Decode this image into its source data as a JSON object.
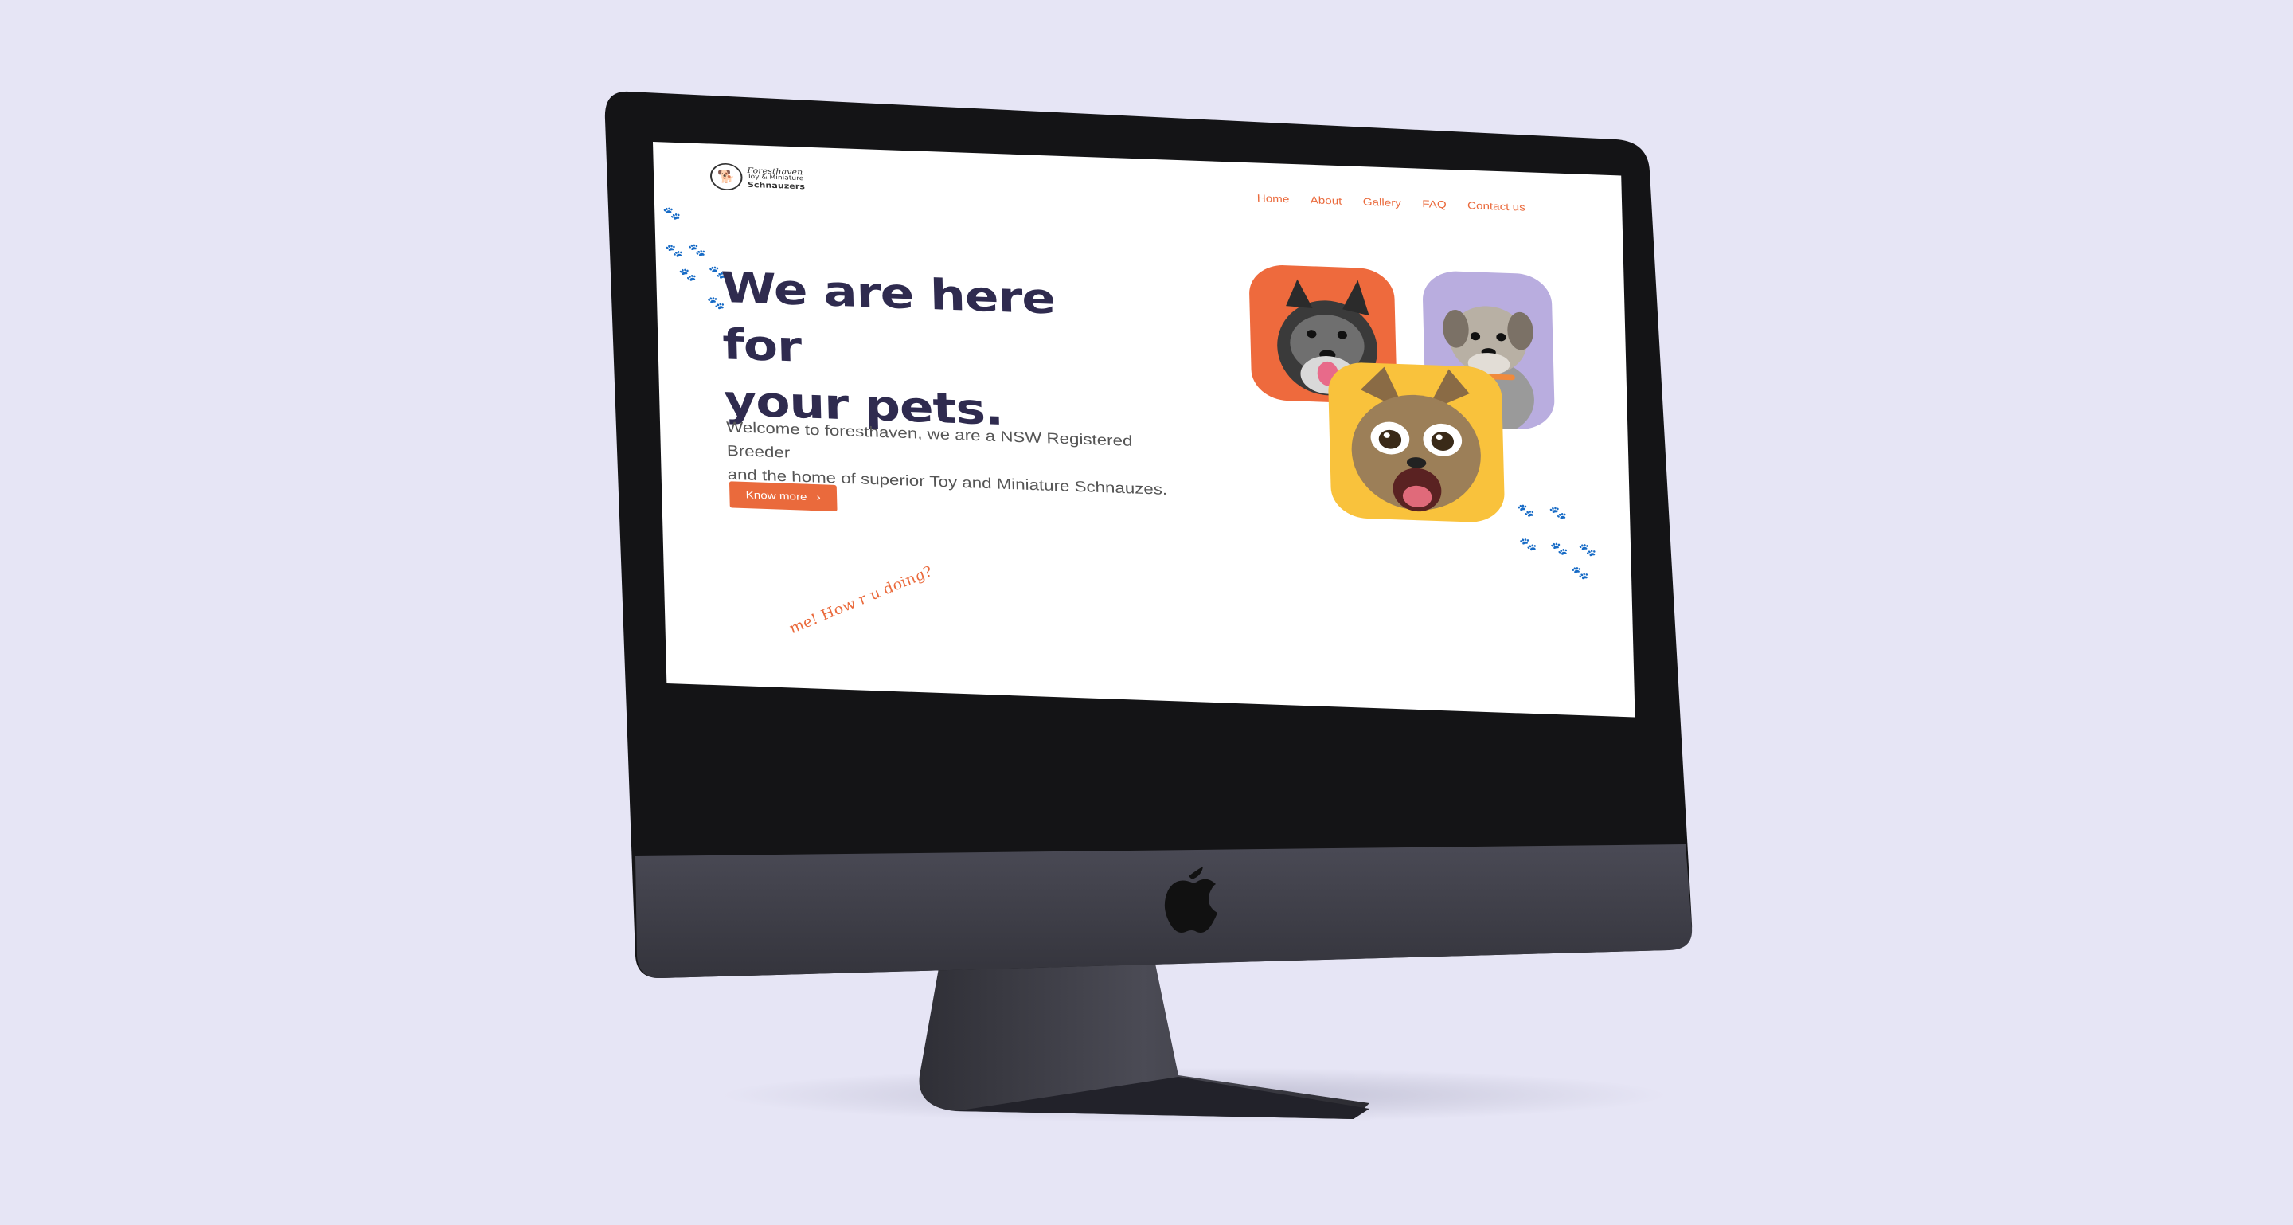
{
  "site": {
    "logo": {
      "line1": "Foresthaven",
      "line2": "Toy & Miniature",
      "line3": "Schnauzers"
    },
    "nav": [
      {
        "label": "Home"
      },
      {
        "label": "About"
      },
      {
        "label": "Gallery"
      },
      {
        "label": "FAQ"
      },
      {
        "label": "Contact us"
      }
    ],
    "hero": {
      "title_line1": "We are here for",
      "title_line2": "your pets.",
      "subtitle_line1": "Welcome to foresthaven, we are a NSW Registered Breeder",
      "subtitle_line2": "and the home of superior Toy and Miniature Schnauzes.",
      "button_label": "Know more",
      "button_icon": "chevron-right-icon"
    },
    "doodle_text": "me! How r u doing?"
  },
  "colors": {
    "accent": "#ea6a3c",
    "title": "#2f2b4f",
    "card_orange": "#ee6a3d",
    "card_purple": "#b9addf",
    "card_yellow": "#f9c23c",
    "background": "#e6e5f5"
  }
}
